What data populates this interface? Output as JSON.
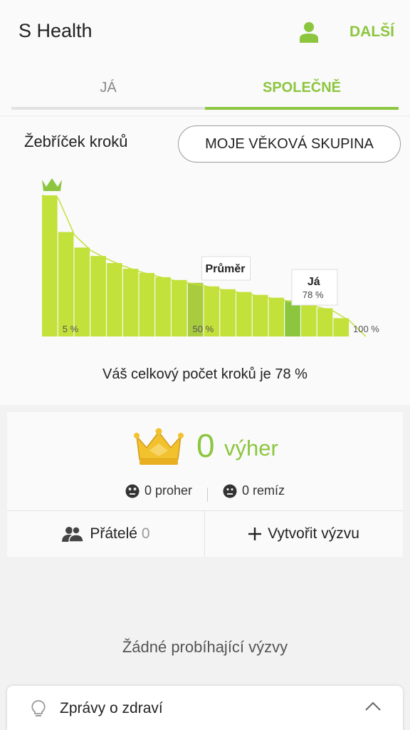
{
  "header": {
    "title": "S Health",
    "profile_icon": "person-icon",
    "more_label": "DALŠÍ"
  },
  "tabs": [
    {
      "label": "JÁ",
      "active": false
    },
    {
      "label": "SPOLEČNĚ",
      "active": true
    }
  ],
  "leaderboard": {
    "title": "Žebříček kroků",
    "age_group_button": "MOJE VĚKOVÁ SKUPINA",
    "top_icon": "crown-icon",
    "summary": "Váš celkový počet kroků je 78 %"
  },
  "chart_data": {
    "type": "area",
    "percentiles": [
      5,
      10,
      15,
      20,
      25,
      30,
      35,
      40,
      45,
      50,
      55,
      60,
      65,
      70,
      75,
      80,
      85,
      90,
      95,
      100
    ],
    "relative_steps": [
      1.0,
      0.74,
      0.63,
      0.57,
      0.52,
      0.48,
      0.45,
      0.42,
      0.4,
      0.38,
      0.355,
      0.335,
      0.315,
      0.295,
      0.275,
      0.255,
      0.23,
      0.2,
      0.13,
      0.0
    ],
    "tick_labels": [
      {
        "percentile": 5,
        "label": "5 %"
      },
      {
        "percentile": 50,
        "label": "50 %"
      },
      {
        "percentile": 100,
        "label": "100 %"
      }
    ],
    "average": {
      "label": "Průměr",
      "percentile": 50
    },
    "me": {
      "label": "Já",
      "value_label": "78 %",
      "percentile": 78
    },
    "colors": {
      "fill": "#c2e13a",
      "average": "#a9cc3e",
      "me": "#8cc63f",
      "crown": "#8cc63f"
    }
  },
  "wins": {
    "count": "0",
    "label": "výher",
    "losses": "0 proher",
    "draws": "0 remíz",
    "icon": "crown-icon"
  },
  "actions": {
    "friends_label": "Přátelé",
    "friends_count": "0",
    "create_label": "Vytvořit výzvu"
  },
  "no_challenges": "Žádné probíhající výzvy",
  "news": {
    "label": "Zprávy o zdraví",
    "icon": "lightbulb-icon",
    "collapse_icon": "chevron-up-icon"
  },
  "colors": {
    "accent": "#8cc63f",
    "background": "#f2f2f2",
    "card": "#fafafa"
  }
}
